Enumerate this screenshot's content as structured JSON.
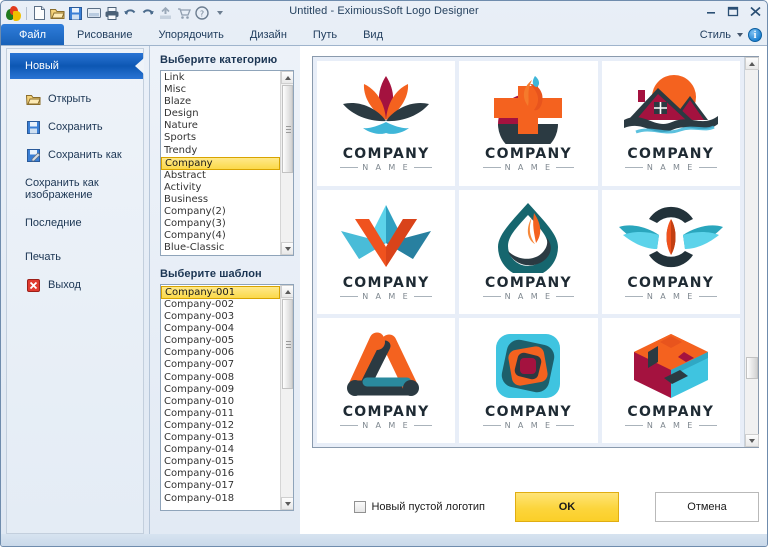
{
  "window": {
    "title": "Untitled  -  EximiousSoft Logo Designer",
    "controls": {
      "minimize": "minimize-icon",
      "maximize": "maximize-icon",
      "close": "close-icon"
    }
  },
  "quick_access": {
    "icons": [
      "app-logo-icon",
      "new-document-icon",
      "open-folder-icon",
      "save-icon",
      "save-all-icon",
      "print-icon",
      "undo-icon",
      "redo-icon",
      "export-icon",
      "cart-icon",
      "help-icon",
      "customize-qat-caret-icon"
    ]
  },
  "ribbon": {
    "tabs": [
      {
        "label": "Файл",
        "active": true
      },
      {
        "label": "Рисование",
        "active": false
      },
      {
        "label": "Упорядочить",
        "active": false
      },
      {
        "label": "Дизайн",
        "active": false
      },
      {
        "label": "Путь",
        "active": false
      },
      {
        "label": "Вид",
        "active": false
      }
    ],
    "style_label": "Стиль",
    "info_glyph": "i"
  },
  "file_menu": {
    "items": [
      {
        "label": "Новый",
        "icon": "none",
        "selected": true
      },
      {
        "label": "Открыть",
        "icon": "open-folder-icon",
        "selected": false
      },
      {
        "label": "Сохранить",
        "icon": "save-icon",
        "selected": false
      },
      {
        "label": "Сохранить как",
        "icon": "save-as-icon",
        "selected": false
      },
      {
        "label": "Сохранить как изображение",
        "icon": "none",
        "selected": false
      },
      {
        "label": "Последние",
        "icon": "none",
        "selected": false
      },
      {
        "label": "Печать",
        "icon": "none",
        "selected": false
      },
      {
        "label": "Выход",
        "icon": "exit-icon",
        "selected": false
      }
    ]
  },
  "category": {
    "title": "Выберите категорию",
    "items": [
      "Link",
      "Misc",
      "Blaze",
      "Design",
      "Nature",
      "Sports",
      "Trendy",
      "Company",
      "Abstract",
      "Activity",
      "Business",
      "Company(2)",
      "Company(3)",
      "Company(4)",
      "Blue-Classic"
    ],
    "selected": "Company"
  },
  "template": {
    "title": "Выберите шаблон",
    "items": [
      "Company-001",
      "Company-002",
      "Company-003",
      "Company-004",
      "Company-005",
      "Company-006",
      "Company-007",
      "Company-008",
      "Company-009",
      "Company-010",
      "Company-011",
      "Company-012",
      "Company-013",
      "Company-014",
      "Company-015",
      "Company-016",
      "Company-017",
      "Company-018"
    ],
    "selected": "Company-001"
  },
  "gallery": {
    "company_label": "COMPANY",
    "name_label": "N A M E",
    "items": [
      {
        "mark": "lotus-flower-mark",
        "colors": [
          "#f4621f",
          "#a4123f",
          "#2b3a42",
          "#3fb6d8"
        ]
      },
      {
        "mark": "cross-flame-mark",
        "colors": [
          "#f4621f",
          "#a4123f",
          "#2b3a42",
          "#3fb6d8"
        ]
      },
      {
        "mark": "house-sun-mark",
        "colors": [
          "#f4621f",
          "#a4123f",
          "#2b3a42",
          "#3fb6d8"
        ]
      },
      {
        "mark": "star-arrow-mark",
        "colors": [
          "#2f9fc0",
          "#5cd3ea",
          "#f0521e",
          "#1d6f8a"
        ]
      },
      {
        "mark": "water-drop-flame-mark",
        "colors": [
          "#16666e",
          "#2b3a42",
          "#f4621f"
        ]
      },
      {
        "mark": "wings-seed-mark",
        "colors": [
          "#2aa6bd",
          "#5cd3ea",
          "#f0521e",
          "#22323a"
        ]
      },
      {
        "mark": "triangle-links-mark",
        "colors": [
          "#f4621f",
          "#2b3a42",
          "#2a8a9e"
        ]
      },
      {
        "mark": "nested-squares-mark",
        "colors": [
          "#3fc4e0",
          "#1d5f6b",
          "#f4621f",
          "#a4123f"
        ]
      },
      {
        "mark": "cube-blocks-mark",
        "colors": [
          "#f4621f",
          "#3fc4e0",
          "#a4123f",
          "#2b3a42"
        ]
      }
    ]
  },
  "footer": {
    "checkbox_label": "Новый пустой логотип",
    "checkbox_checked": false,
    "ok_label": "OK",
    "cancel_label": "Отмена"
  }
}
